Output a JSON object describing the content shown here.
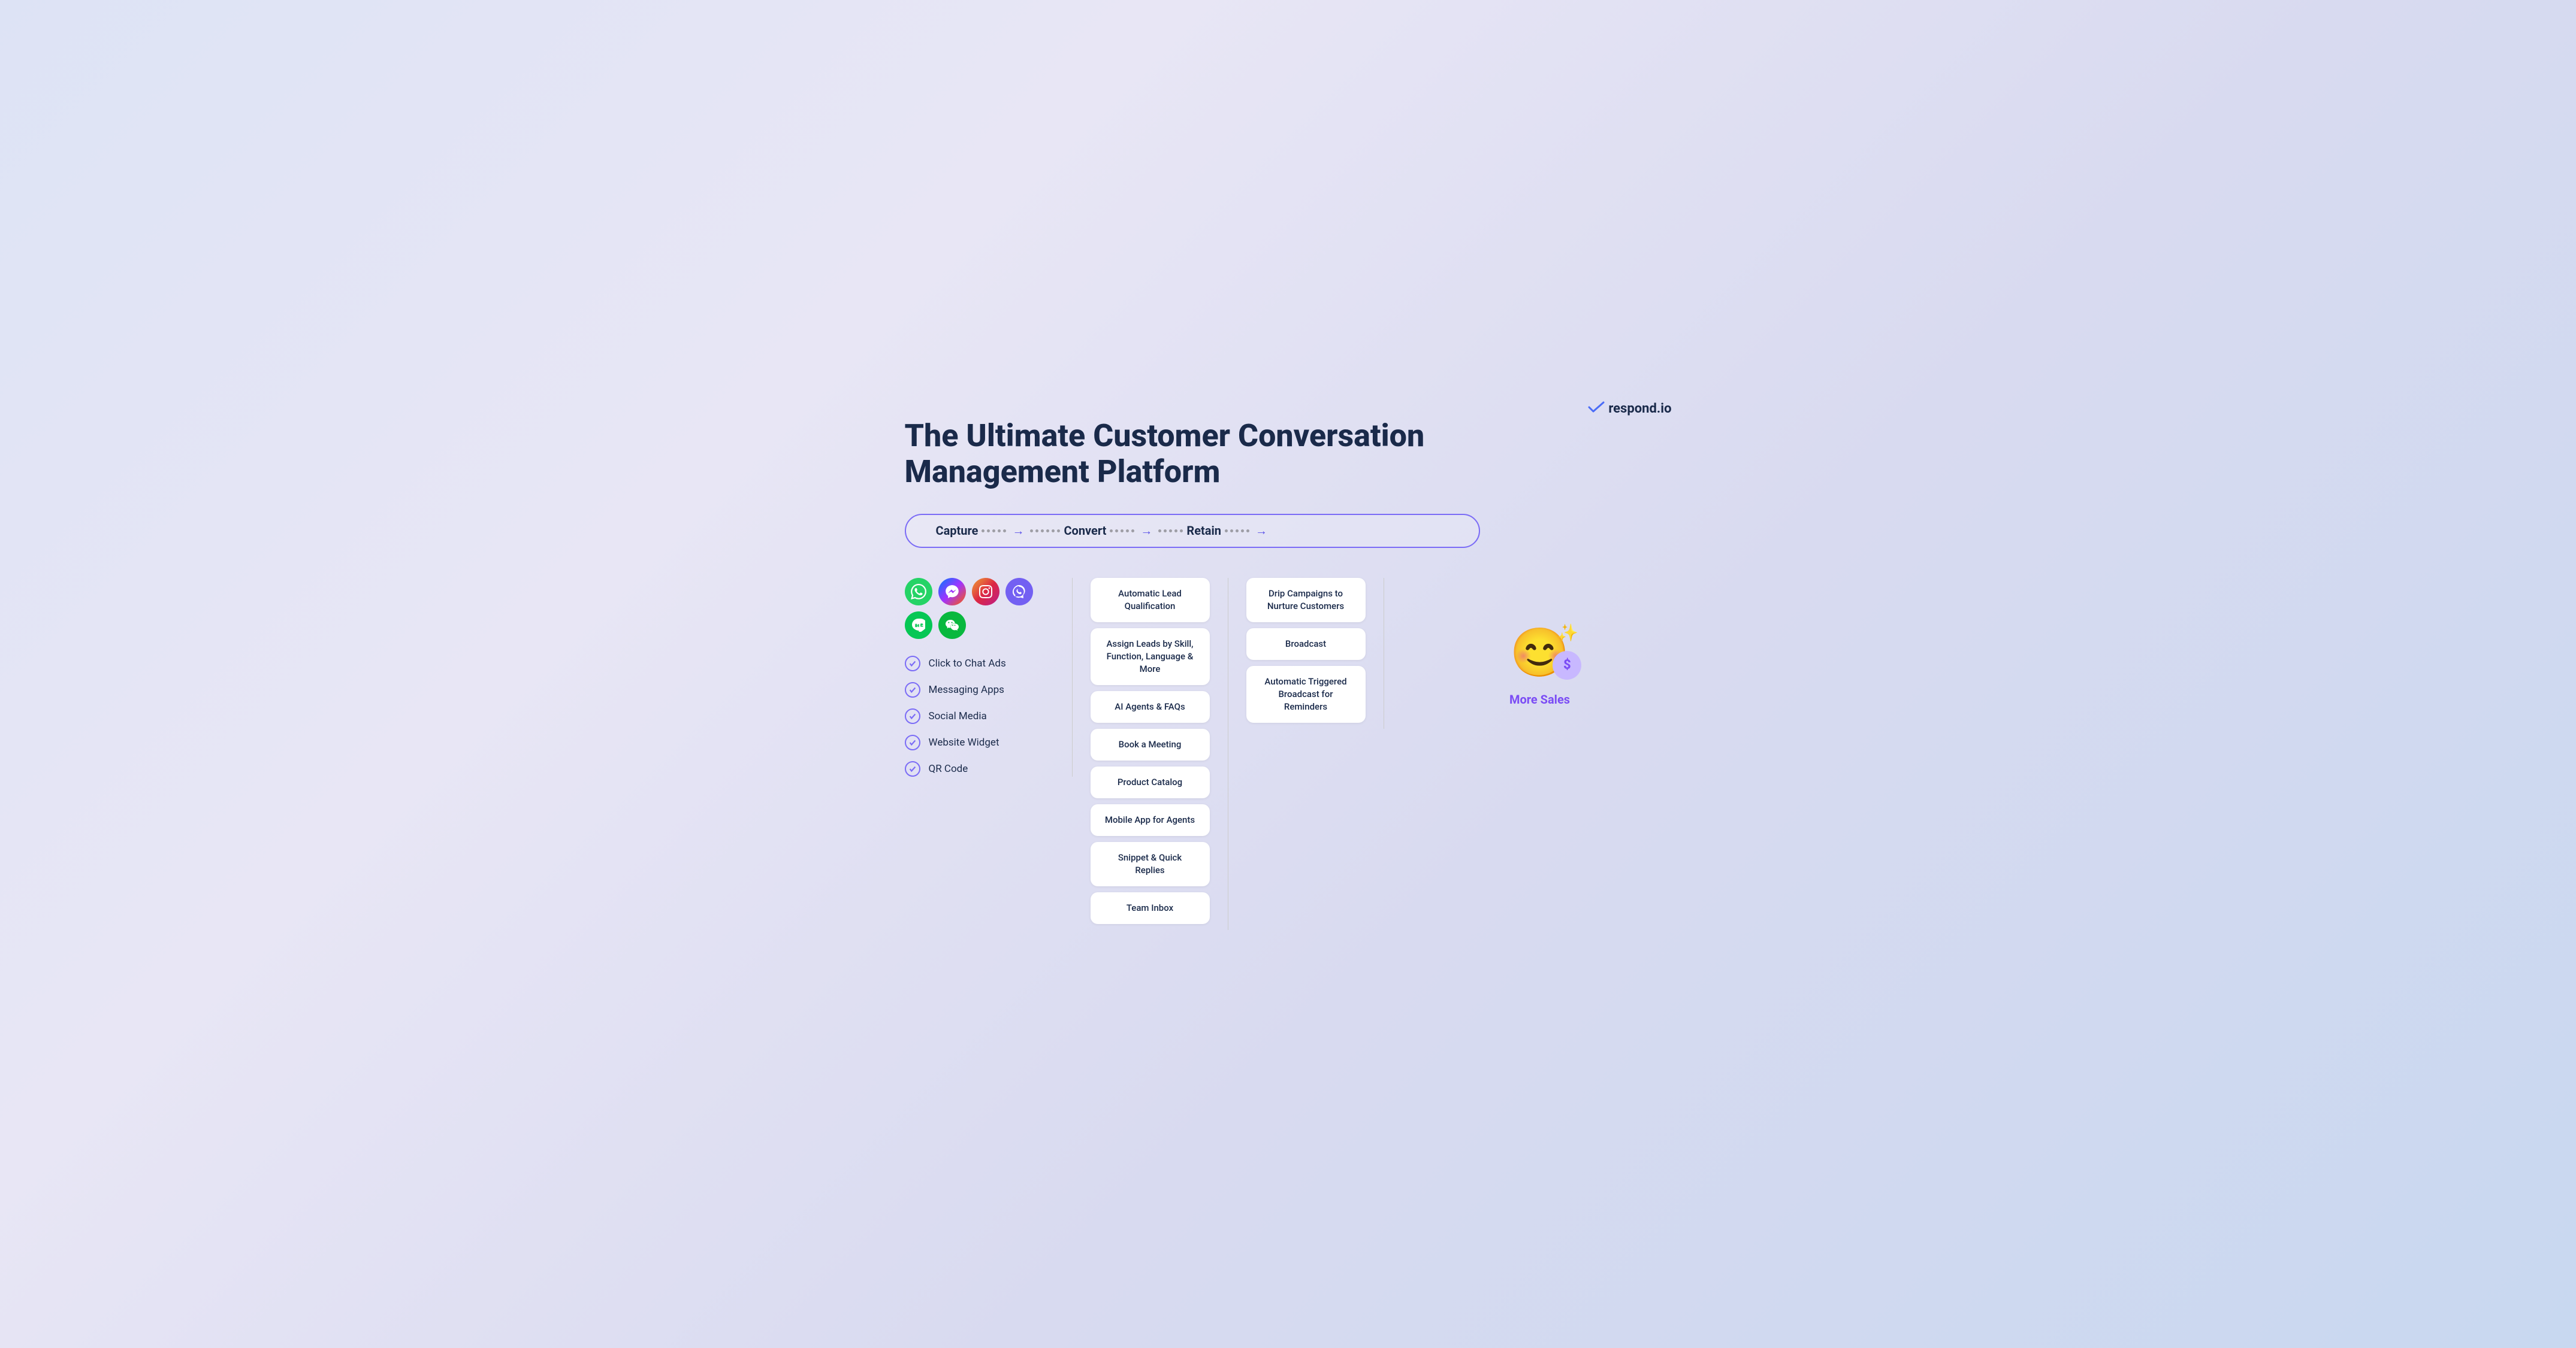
{
  "logo": {
    "brand": "respond.io",
    "check_symbol": "✔"
  },
  "title": "The Ultimate Customer Conversation Management Platform",
  "pipeline": {
    "steps": [
      "Capture",
      "Convert",
      "Retain"
    ],
    "arrow": "→"
  },
  "capture_column": {
    "messaging_icons": [
      {
        "name": "WhatsApp",
        "class": "icon-whatsapp",
        "symbol": "💬"
      },
      {
        "name": "Messenger",
        "class": "icon-messenger",
        "symbol": "💬"
      },
      {
        "name": "Instagram",
        "class": "icon-instagram",
        "symbol": "📷"
      },
      {
        "name": "Viber",
        "class": "icon-viber",
        "symbol": "📞"
      },
      {
        "name": "Line",
        "class": "icon-line",
        "symbol": "💬"
      },
      {
        "name": "WeChat",
        "class": "icon-wechat",
        "symbol": "💬"
      }
    ],
    "items": [
      "Click to Chat Ads",
      "Messaging Apps",
      "Social Media",
      "Website Widget",
      "QR Code"
    ]
  },
  "convert_column": {
    "features": [
      "Automatic Lead Qualification",
      "Assign Leads by Skill, Function, Language & More",
      "AI Agents & FAQs",
      "Book a Meeting",
      "Product Catalog",
      "Mobile App for Agents",
      "Snippet & Quick Replies",
      "Team Inbox"
    ]
  },
  "retain_column": {
    "features": [
      "Drip Campaigns to Nurture Customers",
      "Broadcast",
      "Automatic Triggered Broadcast for Reminders"
    ]
  },
  "result": {
    "emoji": "😊",
    "dollar": "$",
    "sparkle": "✨",
    "label": "More Sales"
  }
}
